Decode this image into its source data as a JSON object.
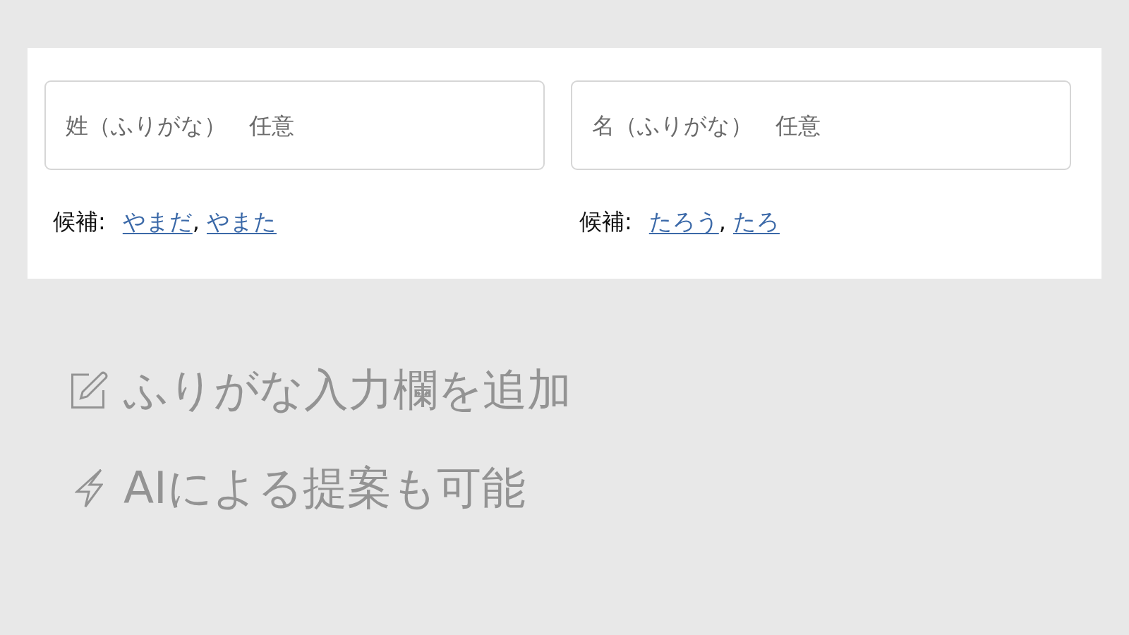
{
  "fields": [
    {
      "placeholder": "姓（ふりがな）　任意",
      "suggestions_label": "候補:",
      "separator": ",",
      "suggestions": [
        "やまだ",
        "やまた"
      ]
    },
    {
      "placeholder": "名（ふりがな）　任意",
      "suggestions_label": "候補:",
      "separator": ",",
      "suggestions": [
        "たろう",
        "たろ"
      ]
    }
  ],
  "features": [
    {
      "kind": "edit",
      "text": "ふりがな入力欄を追加"
    },
    {
      "kind": "ai",
      "text": "AIによる提案も可能"
    }
  ]
}
